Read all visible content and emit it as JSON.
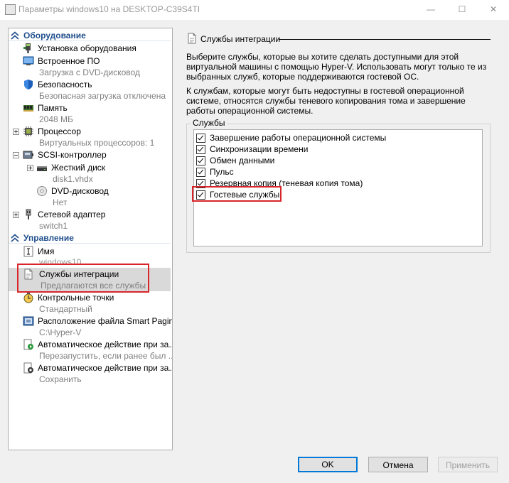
{
  "window": {
    "title": "Параметры windows10 на DESKTOP-C39S4TI",
    "minimize": "—",
    "maximize": "☐",
    "close": "✕"
  },
  "tree": {
    "hardware_header": "Оборудование",
    "add_hardware": "Установка оборудования",
    "firmware": {
      "label": "Встроенное ПО",
      "sub": "Загрузка с DVD-дисковод"
    },
    "security": {
      "label": "Безопасность",
      "sub": "Безопасная загрузка отключена"
    },
    "memory": {
      "label": "Память",
      "sub": "2048 МБ"
    },
    "processor": {
      "label": "Процессор",
      "sub": "Виртуальных процессоров: 1"
    },
    "scsi": {
      "label": "SCSI-контроллер"
    },
    "hard_disk": {
      "label": "Жесткий диск",
      "sub": "disk1.vhdx"
    },
    "dvd": {
      "label": "DVD-дисковод",
      "sub": "Нет"
    },
    "network": {
      "label": "Сетевой адаптер",
      "sub": "switch1"
    },
    "management_header": "Управление",
    "name": {
      "label": "Имя",
      "sub": "windows10"
    },
    "integration": {
      "label": "Службы интеграции",
      "sub": "Предлагаются все службы"
    },
    "checkpoints": {
      "label": "Контрольные точки",
      "sub": "Стандартный"
    },
    "smart_paging": {
      "label": "Расположение файла Smart Paging",
      "sub": "C:\\Hyper-V"
    },
    "auto_start": {
      "label": "Автоматическое действие при за...",
      "sub": "Перезапустить, если ранее был ..."
    },
    "auto_stop": {
      "label": "Автоматическое действие при за...",
      "sub": "Сохранить"
    }
  },
  "panel": {
    "title": "Службы интеграции",
    "desc1": "Выберите службы, которые вы хотите сделать доступными для этой виртуальной машины с помощью Hyper-V. Использовать могут только те из выбранных служб, которые поддерживаются гостевой ОС.",
    "desc2": "К службам, которые могут быть недоступны в гостевой операционной системе, относятся службы теневого копирования тома и завершение работы операционной системы.",
    "group_label": "Службы",
    "services": [
      {
        "label": "Завершение работы операционной системы",
        "checked": true
      },
      {
        "label": "Синхронизации времени",
        "checked": true
      },
      {
        "label": "Обмен данными",
        "checked": true
      },
      {
        "label": "Пульс",
        "checked": true
      },
      {
        "label": "Резервная копия (теневая копия тома)",
        "checked": true
      },
      {
        "label": "Гостевые службы",
        "checked": true
      }
    ]
  },
  "buttons": {
    "ok": "OK",
    "cancel": "Отмена",
    "apply": "Применить"
  },
  "colors": {
    "header_blue": "#1f4e8c",
    "highlight_red": "#d9252a",
    "default_button": "#0078d7",
    "selected_row": "#d9d9d9"
  }
}
